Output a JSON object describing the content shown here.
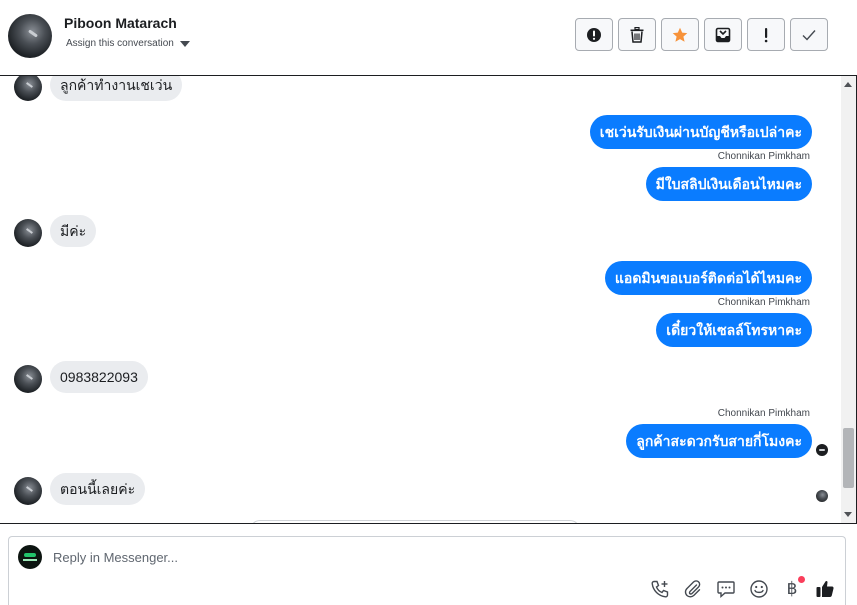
{
  "header": {
    "name": "Piboon Matarach",
    "assign_label": "Assign this conversation",
    "toolbar": [
      {
        "name": "mark-spam-button",
        "icon": "exclamation-circle-icon"
      },
      {
        "name": "delete-button",
        "icon": "trash-icon"
      },
      {
        "name": "star-button",
        "icon": "star-icon",
        "color": "#f7923a"
      },
      {
        "name": "archive-button",
        "icon": "archive-box-icon"
      },
      {
        "name": "priority-button",
        "icon": "exclamation-icon"
      },
      {
        "name": "mark-done-button",
        "icon": "check-icon"
      }
    ]
  },
  "messages": [
    {
      "type": "in",
      "text": "ลูกค้าทำงานเชเว่น"
    },
    {
      "type": "out",
      "text": "เชเว่นรับเงินผ่านบัญชีหรือเปล่าคะ"
    },
    {
      "type": "out",
      "sender": "Chonnikan Pimkham",
      "text": "มีใบสลิปเงินเดือนไหมคะ"
    },
    {
      "type": "in",
      "text": "มีค่ะ"
    },
    {
      "type": "out",
      "text": "แอดมินขอเบอร์ติดต่อได้ไหมคะ"
    },
    {
      "type": "out",
      "sender": "Chonnikan Pimkham",
      "text": "เดี๋ยวให้เซลล์โทรหาคะ"
    },
    {
      "type": "in",
      "text": "0983822093"
    },
    {
      "type": "out",
      "sender": "Chonnikan Pimkham",
      "text": "ลูกค้าสะดวกรับสายกี่โมงคะ"
    },
    {
      "type": "in",
      "text": "ตอนนี้เลยค่ะ"
    }
  ],
  "reply": {
    "placeholder": "Reply in Messenger...",
    "tools": [
      "phone-add-icon",
      "paperclip-icon",
      "chat-bubble-icon",
      "smiley-icon",
      "baht-icon",
      "thumbs-up-icon"
    ],
    "baht_symbol": "฿"
  },
  "colors": {
    "outgoing_bubble": "#0a7cff",
    "incoming_bubble": "#eaecef",
    "star": "#f7923a",
    "notification_dot": "#fa3e5b"
  }
}
